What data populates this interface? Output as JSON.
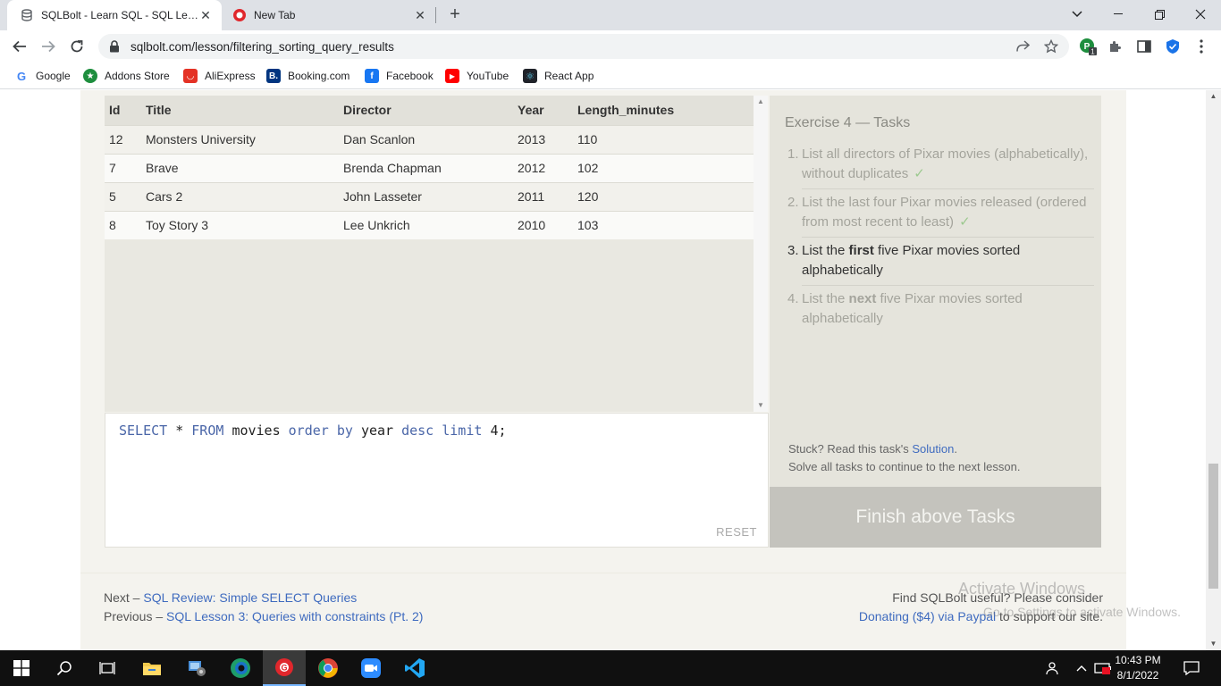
{
  "browser": {
    "tabs": [
      {
        "title": "SQLBolt - Learn SQL - SQL Lesson",
        "active": true
      },
      {
        "title": "New Tab",
        "active": false
      }
    ],
    "url": "sqlbolt.com/lesson/filtering_sorting_query_results",
    "bookmarks": [
      "Google",
      "Addons Store",
      "AliExpress",
      "Booking.com",
      "Facebook",
      "YouTube",
      "React App"
    ]
  },
  "results": {
    "columns": [
      "Id",
      "Title",
      "Director",
      "Year",
      "Length_minutes"
    ],
    "rows": [
      [
        "12",
        "Monsters University",
        "Dan Scanlon",
        "2013",
        "110"
      ],
      [
        "7",
        "Brave",
        "Brenda Chapman",
        "2012",
        "102"
      ],
      [
        "5",
        "Cars 2",
        "John Lasseter",
        "2011",
        "120"
      ],
      [
        "8",
        "Toy Story 3",
        "Lee Unkrich",
        "2010",
        "103"
      ]
    ]
  },
  "editor": {
    "query_tokens": {
      "select": "SELECT",
      "star": "*",
      "from": "FROM",
      "table": "movies",
      "order_by": "order by",
      "column": "year",
      "desc": "desc",
      "limit": "limit",
      "count": "4",
      "semicolon": ";"
    },
    "reset_label": "RESET"
  },
  "exercise": {
    "title": "Exercise 4 — Tasks",
    "tasks": [
      {
        "num": "1.",
        "text": "List all directors of Pixar movies (alphabetically), without duplicates",
        "done": true
      },
      {
        "num": "2.",
        "text": "List the last four Pixar movies released (ordered from most recent to least)",
        "done": true
      },
      {
        "num": "3.",
        "pre": "List the ",
        "bold": "first",
        "post": " five Pixar movies sorted alphabetically",
        "done": false
      },
      {
        "num": "4.",
        "pre": "List the ",
        "bold": "next",
        "post": " five Pixar movies sorted alphabetically",
        "done": false
      }
    ],
    "check_mark": "✓",
    "stuck_text": "Stuck? Read this task's ",
    "solution_link": "Solution",
    "stuck_end": ".",
    "solve_all_text": "Solve all tasks to continue to the next lesson.",
    "finish_button": "Finish above Tasks"
  },
  "footer": {
    "next_prefix": "Next – ",
    "next_link": "SQL Review: Simple SELECT Queries",
    "prev_prefix": "Previous – ",
    "prev_link": "SQL Lesson 3: Queries with constraints (Pt. 2)",
    "find_text": "Find SQLBolt useful? Please consider",
    "donate_link": "Donating ($4) via Paypal",
    "donate_suffix": " to support our site."
  },
  "watermark": {
    "line1": "Activate Windows",
    "line2": "Go to Settings to activate Windows."
  },
  "taskbar": {
    "time": "10:43 PM",
    "date": "8/1/2022"
  }
}
